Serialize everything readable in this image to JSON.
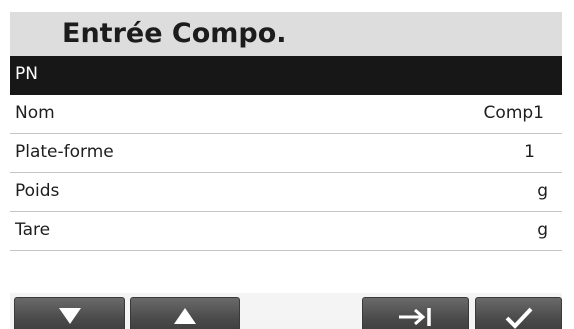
{
  "title": "Entrée Compo.",
  "rows": [
    {
      "label": "PN",
      "value": ""
    },
    {
      "label": "Nom",
      "value": "Comp1"
    },
    {
      "label": "Plate-forme",
      "value": "1"
    },
    {
      "label": "Poids",
      "value": "g"
    },
    {
      "label": "Tare",
      "value": "g"
    }
  ],
  "softkeys": [
    {
      "icon": "arrow-down-icon"
    },
    {
      "icon": "arrow-up-icon"
    },
    {
      "icon": "tab-next-icon"
    },
    {
      "icon": "checkmark-icon"
    }
  ]
}
